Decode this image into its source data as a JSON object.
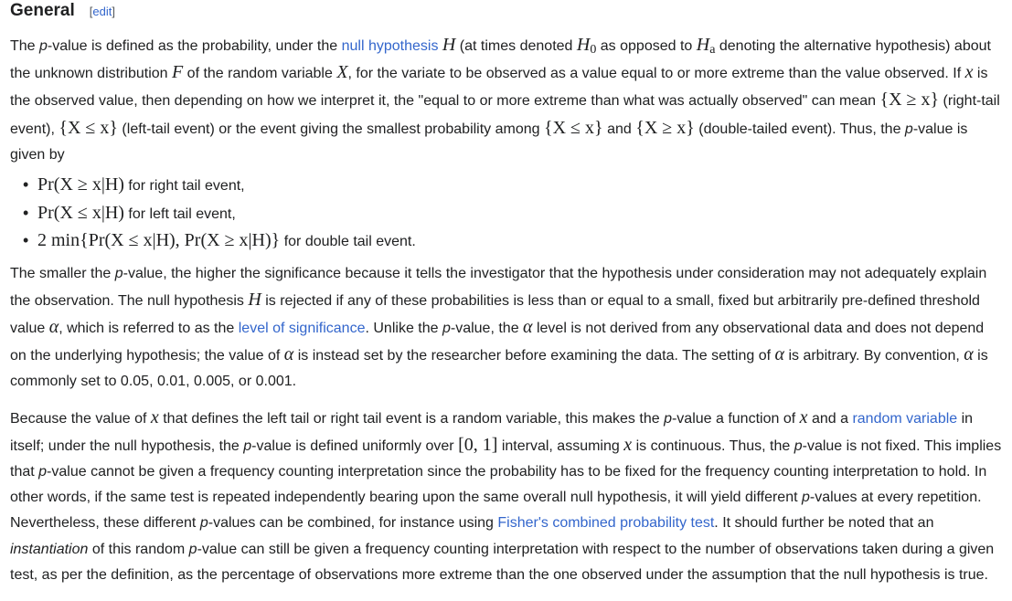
{
  "section": {
    "title": "General",
    "edit_open": "[",
    "edit_label": "edit",
    "edit_close": "]"
  },
  "para1": {
    "t1": "The ",
    "p_italic": "p",
    "t2": "-value is defined as the probability, under the ",
    "link_null": "null hypothesis",
    "t3": " ",
    "m_H": "H",
    "t4": " (at times denoted ",
    "m_H0_base": "H",
    "m_H0_sub": "0",
    "t5": " as opposed to ",
    "m_Ha_base": "H",
    "m_Ha_sub": "a",
    "t6": " denoting the alternative hypothesis) about the unknown distribution ",
    "m_F": "F",
    "t7": " of the random variable ",
    "m_X": "X",
    "t8": ", for the variate to be observed as a value equal to or more extreme than the value observed. If ",
    "m_x1": "x",
    "t9": " is the observed value, then depending on how we interpret it, the \"equal to or more extreme than what was actually observed\" can mean ",
    "m_right": "{X ≥ x}",
    "t10": " (right-tail event), ",
    "m_left": "{X ≤ x}",
    "t11": " (left-tail event) or the event giving the smallest probability among ",
    "m_le": "{X ≤ x}",
    "t12": " and ",
    "m_ge": "{X ≥ x}",
    "t13": " (double-tailed event). Thus, the ",
    "p_italic2": "p",
    "t14": "-value is given by"
  },
  "list": [
    {
      "formula": "Pr(X ≥ x|H)",
      "text": " for right tail event,"
    },
    {
      "formula": "Pr(X ≤ x|H)",
      "text": " for left tail event,"
    },
    {
      "formula": "2 min{Pr(X ≤ x|H), Pr(X ≥ x|H)}",
      "text": " for double tail event."
    }
  ],
  "para2": {
    "t1": "The smaller the ",
    "p1": "p",
    "t2": "-value, the higher the significance because it tells the investigator that the hypothesis under consideration may not adequately explain the observation. The null hypothesis ",
    "m_H": "H",
    "t3": " is rejected if any of these probabilities is less than or equal to a small, fixed but arbitrarily pre-defined threshold value ",
    "m_alpha1": "α",
    "t4": ", which is referred to as the ",
    "link_level": "level of significance",
    "t5": ". Unlike the ",
    "p2": "p",
    "t6": "-value, the ",
    "m_alpha2": "α",
    "t7": " level is not derived from any observational data and does not depend on the underlying hypothesis; the value of ",
    "m_alpha3": "α",
    "t8": " is instead set by the researcher before examining the data. The setting of ",
    "m_alpha4": "α",
    "t9": " is arbitrary. By convention, ",
    "m_alpha5": "α",
    "t10": " is commonly set to 0.05, 0.01, 0.005, or 0.001."
  },
  "para3": {
    "t1": "Because the value of ",
    "m_x1": "x",
    "t2": " that defines the left tail or right tail event is a random variable, this makes the ",
    "p1": "p",
    "t3": "-value a function of ",
    "m_x2": "x",
    "t4": " and a ",
    "link_rv": "random variable",
    "t5": " in itself; under the null hypothesis, the ",
    "p2": "p",
    "t6": "-value is defined uniformly over ",
    "m_interval": "[0, 1]",
    "t7": " interval, assuming ",
    "m_x3": "x",
    "t8": " is continuous. Thus, the ",
    "p3": "p",
    "t9": "-value is not fixed. This implies that ",
    "p4": "p",
    "t10": "-value cannot be given a frequency counting interpretation since the probability has to be fixed for the frequency counting interpretation to hold. In other words, if the same test is repeated independently bearing upon the same overall null hypothesis, it will yield different ",
    "p5": "p",
    "t11": "-values at every repetition. Nevertheless, these different ",
    "p6": "p",
    "t12": "-values can be combined, for instance using ",
    "link_fisher": "Fisher's combined probability test",
    "t13": ". It should further be noted that an ",
    "em_inst": "instantiation",
    "t14": " of this random ",
    "p7": "p",
    "t15": "-value can still be given a frequency counting interpretation with respect to the number of observations taken during a given test, as per the definition, as the percentage of observations more extreme than the one observed under the assumption that the null hypothesis is true."
  }
}
